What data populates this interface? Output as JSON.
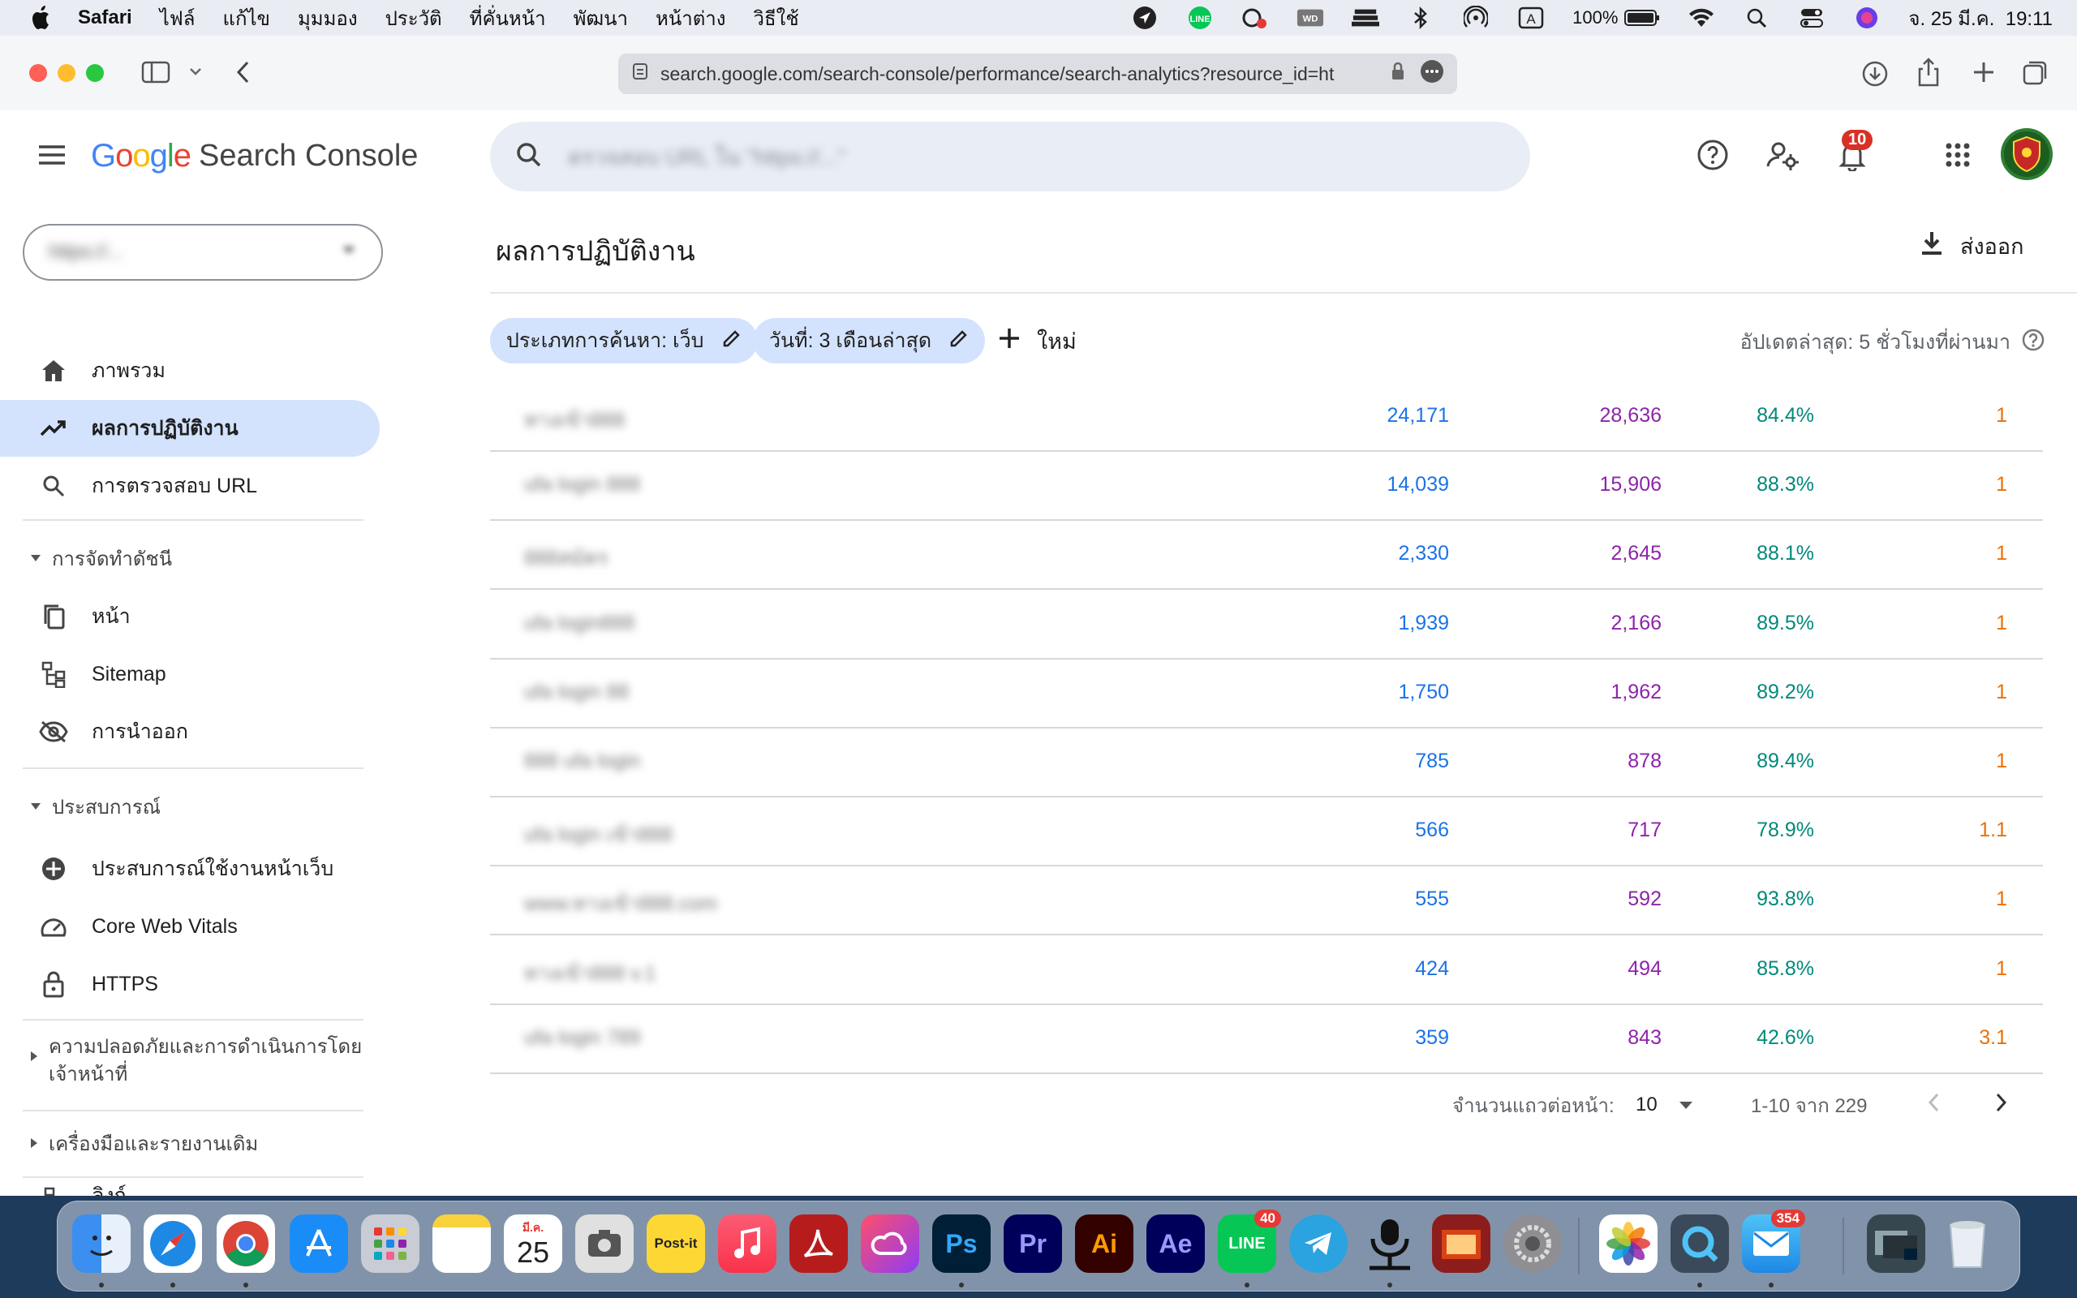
{
  "menubar": {
    "app": "Safari",
    "items": [
      "ไฟล์",
      "แก้ไข",
      "มุมมอง",
      "ประวัติ",
      "ที่คั่นหน้า",
      "พัฒนา",
      "หน้าต่าง",
      "วิธีใช้"
    ],
    "battery": "100%",
    "input_indicator": "A",
    "datetime": "จ. 25 มี.ค.  19:11"
  },
  "browser": {
    "url": "search.google.com/search-console/performance/search-analytics?resource_id=ht"
  },
  "header": {
    "brand_google": "Google",
    "brand_product": "Search Console",
    "search_placeholder": "ตรวจสอบ URL ใน \"https://...\"",
    "notification_count": "10"
  },
  "sidebar": {
    "property": "https://...",
    "overview": "ภาพรวม",
    "performance": "ผลการปฏิบัติงาน",
    "url_inspection": "การตรวจสอบ URL",
    "indexing_section": "การจัดทำดัชนี",
    "pages": "หน้า",
    "sitemap": "Sitemap",
    "removals": "การนำออก",
    "experience_section": "ประสบการณ์",
    "page_experience": "ประสบการณ์ใช้งานหน้าเว็บ",
    "core_web_vitals": "Core Web Vitals",
    "https": "HTTPS",
    "security_section_line1": "ความปลอดภัยและการดำเนินการโดย",
    "security_section_line2": "เจ้าหน้าที่",
    "legacy_section": "เครื่องมือและรายงานเดิม",
    "links": "ลิงก์"
  },
  "main": {
    "title": "ผลการปฏิบัติงาน",
    "export": "ส่งออก",
    "filter_search_type": "ประเภทการค้นหา: เว็บ",
    "filter_date": "วันที่: 3 เดือนล่าสุด",
    "new_button": "ใหม่",
    "last_updated": "อัปเดตล่าสุด: 5 ชั่วโมงที่ผ่านมา"
  },
  "table": {
    "rows": [
      {
        "query": "ทางเข้า888",
        "clicks": "24,171",
        "impressions": "28,636",
        "ctr": "84.4%",
        "position": "1"
      },
      {
        "query": "ufa login 888",
        "clicks": "14,039",
        "impressions": "15,906",
        "ctr": "88.3%",
        "position": "1"
      },
      {
        "query": "888สมัคร",
        "clicks": "2,330",
        "impressions": "2,645",
        "ctr": "88.1%",
        "position": "1"
      },
      {
        "query": "ufa login888",
        "clicks": "1,939",
        "impressions": "2,166",
        "ctr": "89.5%",
        "position": "1"
      },
      {
        "query": "ufa login 88",
        "clicks": "1,750",
        "impressions": "1,962",
        "ctr": "89.2%",
        "position": "1"
      },
      {
        "query": "888 ufa login",
        "clicks": "785",
        "impressions": "878",
        "ctr": "89.4%",
        "position": "1"
      },
      {
        "query": "ufa login เข้า888",
        "clicks": "566",
        "impressions": "717",
        "ctr": "78.9%",
        "position": "1.1"
      },
      {
        "query": "www.ทางเข้า888.com",
        "clicks": "555",
        "impressions": "592",
        "ctr": "93.8%",
        "position": "1"
      },
      {
        "query": "ทางเข้า888 v.1",
        "clicks": "424",
        "impressions": "494",
        "ctr": "85.8%",
        "position": "1"
      },
      {
        "query": "ufa login 789",
        "clicks": "359",
        "impressions": "843",
        "ctr": "42.6%",
        "position": "3.1"
      }
    ],
    "rows_per_page_label": "จำนวนแถวต่อหน้า:",
    "rows_per_page": "10",
    "range": "1-10 จาก 229"
  },
  "dock": {
    "calendar_month": "มี.ค.",
    "calendar_day": "25",
    "line_badge": "40",
    "mail_badge": "354",
    "apps": [
      "Finder",
      "Safari",
      "Chrome",
      "App Store",
      "Launchpad",
      "Notes",
      "Calendar",
      "Screenshot",
      "Post-it",
      "Music",
      "Acrobat",
      "Creative Cloud",
      "Ps",
      "Pr",
      "Ai",
      "Ae",
      "LINE",
      "Telegram",
      "Voice",
      "Photo Booth",
      "System Settings",
      "Photos",
      "QuickTime",
      "Mail",
      "Downloads",
      "Trash"
    ]
  },
  "colors": {
    "clicks": "#1a73e8",
    "impressions": "#8e24aa",
    "ctr": "#00897b",
    "position": "#e8710a",
    "active_nav": "#d3e3fd"
  }
}
